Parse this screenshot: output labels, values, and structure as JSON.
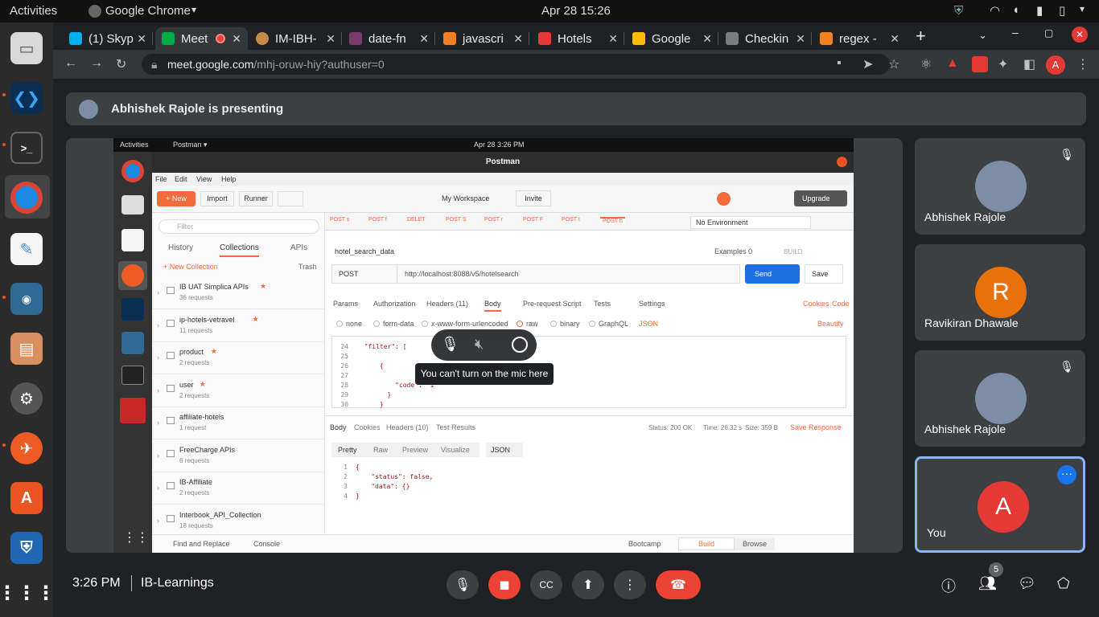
{
  "system_bar": {
    "activities": "Activities",
    "app": "Google Chrome",
    "app_caret": "▾",
    "clock": "Apr 28  15:26"
  },
  "tabs": [
    {
      "label": "(1) Skyp",
      "color": "#00aff0"
    },
    {
      "label": "Meet",
      "color": "#00ac47"
    },
    {
      "label": "IM-IBH-",
      "color": "#c68a4b"
    },
    {
      "label": "date-fn",
      "color": "#7b3b6b"
    },
    {
      "label": "javascri",
      "color": "#f48024"
    },
    {
      "label": "Hotels",
      "color": "#e53935"
    },
    {
      "label": "Google",
      "color": "#fbbc04"
    },
    {
      "label": "Checkin",
      "color": "#7b7b7b"
    },
    {
      "label": "regex -",
      "color": "#f48024"
    }
  ],
  "omnibox": {
    "host": "meet.google.com",
    "path": "/mhj-oruw-hiy?authuser=0"
  },
  "profile_initial": "A",
  "presenting": "Abhishek Rajole is presenting",
  "participants": [
    {
      "name": "Abhishek Rajole",
      "initial": "",
      "color": "#7c8da5",
      "muted": true
    },
    {
      "name": "Ravikiran Dhawale",
      "initial": "R",
      "color": "#e8710a",
      "muted": false
    },
    {
      "name": "Abhishek Rajole",
      "initial": "",
      "color": "#7c8da5",
      "muted": true
    },
    {
      "name": "You",
      "initial": "A",
      "color": "#e53935",
      "muted": false
    }
  ],
  "bottom": {
    "time": "3:26 PM",
    "meeting": "IB-Learnings",
    "people_count": "5"
  },
  "mic_popup": {
    "tooltip": "You can't turn on the mic here"
  },
  "postman": {
    "os_activities": "Activities",
    "os_app": "Postman ▾",
    "os_clock": "Apr 28  3:26 PM",
    "title": "Postman",
    "menu": [
      "File",
      "Edit",
      "View",
      "Help"
    ],
    "new_btn": "+ New",
    "import_btn": "Import",
    "runner_btn": "Runner",
    "workspace": "My Workspace",
    "invite": "Invite",
    "upgrade": "Upgrade",
    "filter_placeholder": "Filter",
    "side_tabs": [
      "History",
      "Collections",
      "APIs"
    ],
    "new_collection": "+ New Collection",
    "trash": "Trash",
    "collections": [
      {
        "name": "IB UAT Simplica APIs",
        "count": "36 requests",
        "star": true
      },
      {
        "name": "ip-hotels-vetravel",
        "count": "11 requests",
        "star": true
      },
      {
        "name": "product",
        "count": "2 requests",
        "star": true
      },
      {
        "name": "user",
        "count": "2 requests",
        "star": true
      },
      {
        "name": "affiliate-hotels",
        "count": "1 request",
        "star": false
      },
      {
        "name": "FreeCharge APIs",
        "count": "6 requests",
        "star": false
      },
      {
        "name": "IB-Affiliate",
        "count": "2 requests",
        "star": false
      },
      {
        "name": "Interbook_API_Collection",
        "count": "18 requests",
        "star": false
      }
    ],
    "req_tabs": [
      "POST s",
      "POST f",
      "DELET",
      "POST S",
      "POST r",
      "POST F",
      "POST t",
      "POST h"
    ],
    "environment": "No Environment",
    "request_name": "hotel_search_data",
    "examples": "Examples",
    "examples_count": "0",
    "build": "BUILD",
    "method": "POST",
    "url": "http://localhost:8088/v5/hotelsearch",
    "send": "Send",
    "save": "Save",
    "param_tabs": [
      "Params",
      "Authorization",
      "Headers (11)",
      "Body",
      "Pre-request Script",
      "Tests",
      "Settings"
    ],
    "cookies": "Cookies",
    "code_link": "Code",
    "body_types": [
      "none",
      "form-data",
      "x-www-form-urlencoded",
      "raw",
      "binary",
      "GraphQL"
    ],
    "json": "JSON",
    "beautify": "Beautify",
    "editor_lines": [
      {
        "n": "24",
        "t": "  \"filter\": ["
      },
      {
        "n": "25",
        "t": ""
      },
      {
        "n": "26",
        "t": "      {"
      },
      {
        "n": "27",
        "t": ""
      },
      {
        "n": "28",
        "t": "          \"code\": \"1\""
      },
      {
        "n": "29",
        "t": "        }"
      },
      {
        "n": "30",
        "t": "      }"
      }
    ],
    "resp_tabs": [
      "Body",
      "Cookies",
      "Headers (10)",
      "Test Results"
    ],
    "status": "Status: 200 OK",
    "time": "Time: 26.32 s",
    "size": "Size: 359 B",
    "save_response": "Save Response",
    "view_tabs": [
      "Pretty",
      "Raw",
      "Preview",
      "Visualize"
    ],
    "resp_format": "JSON",
    "resp_lines": [
      {
        "n": "1",
        "t": "{"
      },
      {
        "n": "2",
        "t": "    \"status\": false,"
      },
      {
        "n": "3",
        "t": "    \"data\": {}"
      },
      {
        "n": "4",
        "t": "}"
      }
    ],
    "footer": {
      "find": "Find and Replace",
      "console": "Console",
      "bootcamp": "Bootcamp",
      "build": "Build",
      "browse": "Browse"
    }
  }
}
